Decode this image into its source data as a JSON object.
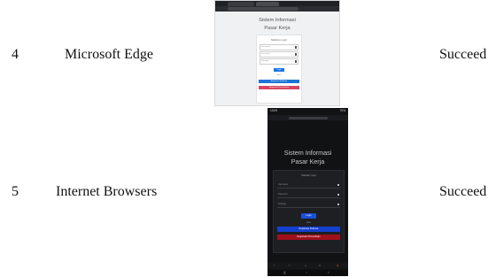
{
  "rows": [
    {
      "number": "4",
      "browser": "Microsoft Edge",
      "result": "Succeed",
      "screenshot": {
        "title": "Sistem Informasi",
        "subtitle": "Pasar Kerja",
        "card_title": "Silahkan Login",
        "fields": [
          "Username",
          "Password",
          "Sebagai"
        ],
        "login_label": "Login",
        "or_label": "atau",
        "register_seeker": "Registrasi Pelamar",
        "register_company": "Registrasi Perusahaan"
      }
    },
    {
      "number": "5",
      "browser": "Internet Browsers",
      "result": "Succeed",
      "screenshot": {
        "time": "13:09",
        "battery": "70%",
        "title": "Sistem Informasi",
        "subtitle": "Pasar Kerja",
        "card_title": "Silahkan Login",
        "fields": [
          "Username",
          "Password",
          "Sebagai"
        ],
        "login_label": "Login",
        "or_label": "atau",
        "register_seeker": "Registrasi Pelamar",
        "register_company": "Registrasi Perusahaan"
      }
    }
  ]
}
